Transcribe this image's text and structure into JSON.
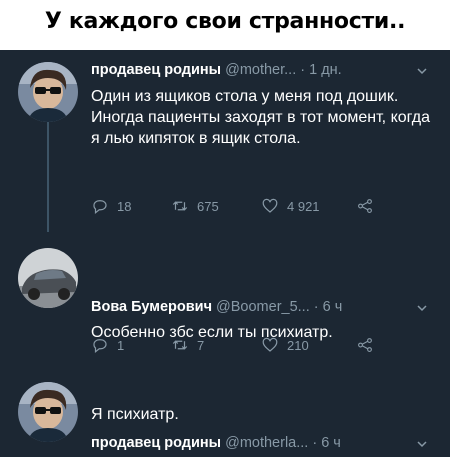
{
  "meme_title": "У каждого свои странности..",
  "tweets": [
    {
      "name": "продавец родины",
      "handle": "@mother...",
      "time": "· 1 дн.",
      "text": "Один из ящиков стола у меня под дошик. Иногда пациенты заходят в тот момент, когда я лью кипяток в ящик стола.",
      "replies": "18",
      "retweets": "675",
      "likes": "4 921"
    },
    {
      "name": "Вова Бумерович",
      "handle": "@Boomer_5...",
      "time": "· 6 ч",
      "text": "Особенно збс если ты психиатр.",
      "replies": "1",
      "retweets": "7",
      "likes": "210"
    },
    {
      "name": "продавец родины",
      "handle": "@motherla...",
      "time": "· 6 ч",
      "text": "Я психиатр."
    }
  ],
  "icons": {
    "reply": "reply-icon",
    "retweet": "retweet-icon",
    "like": "heart-icon",
    "share": "share-icon",
    "more": "chevron-down-icon"
  },
  "colors": {
    "background": "#1c2733",
    "name": "#ffffff",
    "meta": "#8899a6",
    "thread_line": "#3d5466"
  }
}
